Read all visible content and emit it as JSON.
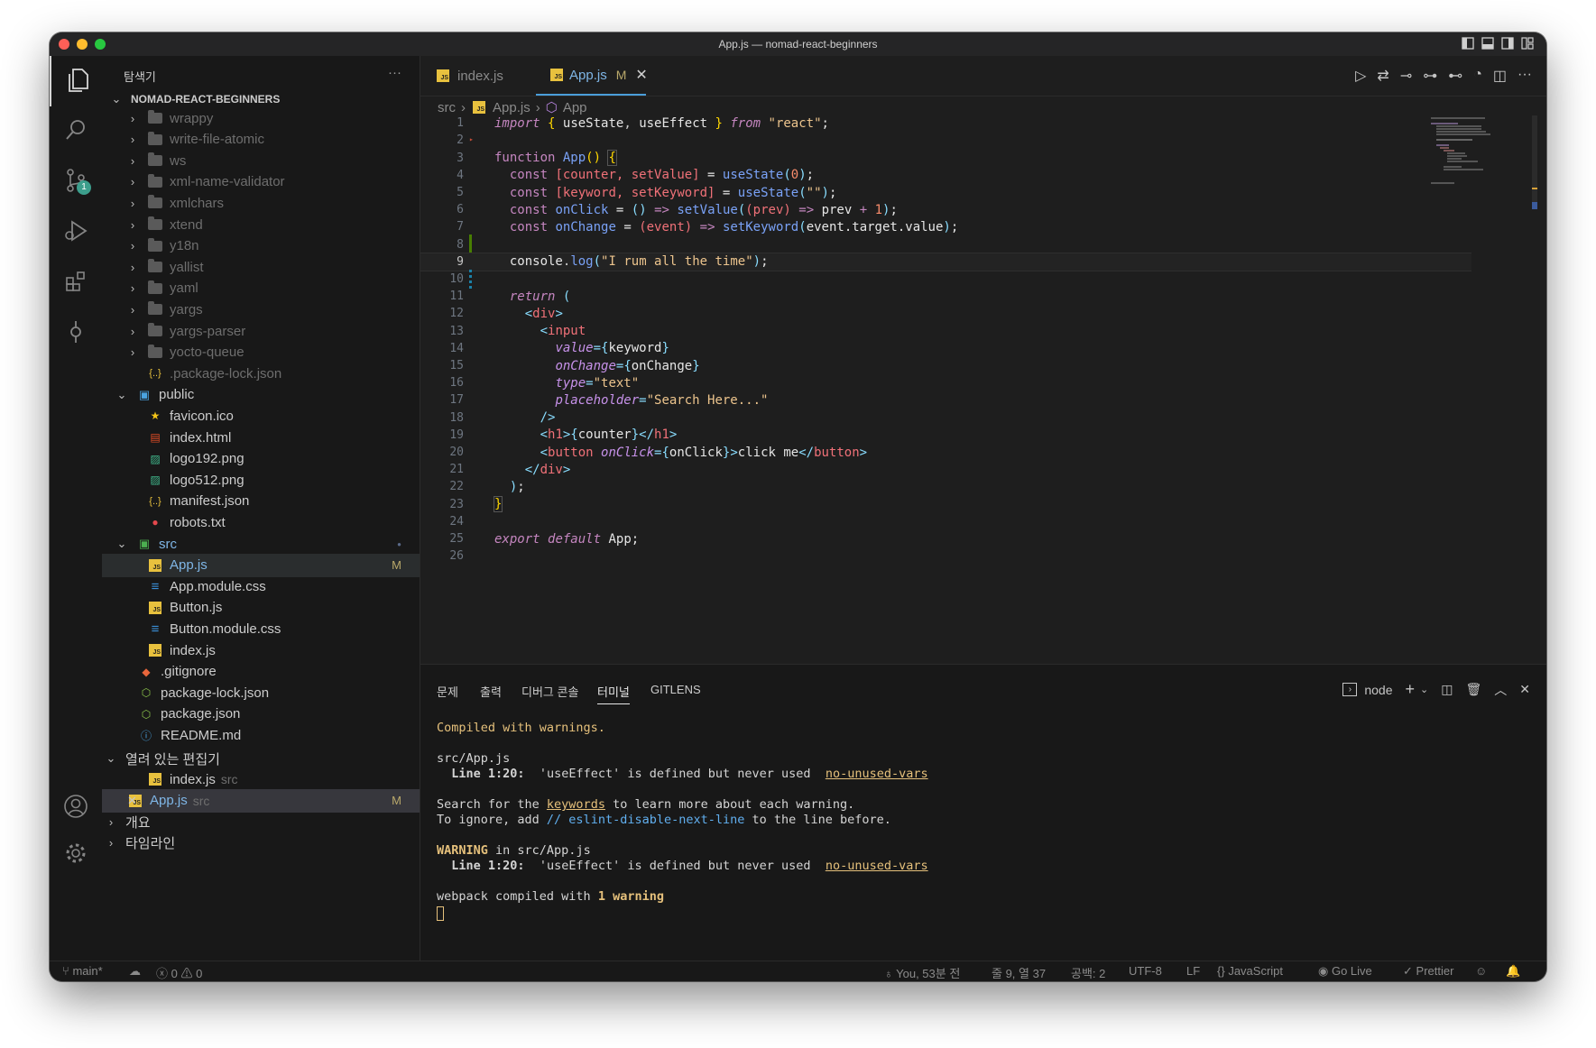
{
  "window": {
    "title": "App.js — nomad-react-beginners",
    "traffic_colors": [
      "#ff5f57",
      "#febc2e",
      "#28c840"
    ]
  },
  "activity_bar": {
    "items": [
      "files-icon",
      "search-icon",
      "source-control-icon",
      "run-debug-icon",
      "extensions-icon",
      "git-commit-icon",
      "account-icon",
      "settings-gear-icon"
    ],
    "scm_badge": "1"
  },
  "sidebar": {
    "header": "탐색기",
    "more": "···",
    "project": "NOMAD-REACT-BEGINNERS",
    "node_modules_folders": [
      "wrappy",
      "write-file-atomic",
      "ws",
      "xml-name-validator",
      "xmlchars",
      "xtend",
      "y18n",
      "yallist",
      "yaml",
      "yargs",
      "yargs-parser",
      "yocto-queue"
    ],
    "package_lock_inner": ".package-lock.json",
    "public_folder": "public",
    "public_files": [
      "favicon.ico",
      "index.html",
      "logo192.png",
      "logo512.png",
      "manifest.json",
      "robots.txt"
    ],
    "src_folder": "src",
    "src_files": [
      "App.js",
      "App.module.css",
      "Button.js",
      "Button.module.css",
      "index.js"
    ],
    "root_files": [
      ".gitignore",
      "package-lock.json",
      "package.json",
      "README.md"
    ],
    "modified_mark": "M",
    "open_editors": {
      "label": "열려 있는 편집기",
      "items": [
        {
          "name": "index.js",
          "dir": "src"
        },
        {
          "name": "App.js",
          "dir": "src",
          "mark": "M"
        }
      ]
    },
    "outline": "개요",
    "timeline": "타임라인"
  },
  "tabs": [
    {
      "label": "index.js"
    },
    {
      "label": "App.js",
      "mark": "M"
    }
  ],
  "breadcrumb": {
    "folder": "src",
    "file": "App.js",
    "symbol": "App"
  },
  "editor": {
    "line_numbers": [
      "1",
      "2",
      "3",
      "4",
      "5",
      "6",
      "7",
      "8",
      "9",
      "10",
      "11",
      "12",
      "13",
      "14",
      "15",
      "16",
      "17",
      "18",
      "19",
      "20",
      "21",
      "22",
      "23",
      "24",
      "25",
      "26"
    ],
    "current_line": 9
  },
  "panel": {
    "tabs": [
      "문제",
      "출력",
      "디버그 콘솔",
      "터미널",
      "GITLENS"
    ],
    "active_tab": "터미널",
    "terminal_name": "node",
    "terminal": {
      "compiled": "Compiled with warnings.",
      "file": "src/App.js",
      "line_prefix": "Line 1:20:",
      "warning_text": "'useEffect' is defined but never used",
      "rule": "no-unused-vars",
      "search_a": "Search for the ",
      "keywords": "keywords",
      "search_b": " to learn more about each warning.",
      "ignore_a": "To ignore, add ",
      "ignore_code": "// eslint-disable-next-line",
      "ignore_b": " to the line before.",
      "warning_label": "WARNING",
      "warning_in": " in src/App.js",
      "webpack_a": "webpack compiled with ",
      "webpack_b": "1 warning"
    }
  },
  "status_bar": {
    "branch": "main*",
    "errors": "0",
    "warnings": "0",
    "blame": "You, 53분 전",
    "position": "줄 9, 열 37",
    "spaces": "공백: 2",
    "encoding": "UTF-8",
    "eol": "LF",
    "language": "JavaScript",
    "go_live": "Go Live",
    "prettier": "Prettier"
  }
}
